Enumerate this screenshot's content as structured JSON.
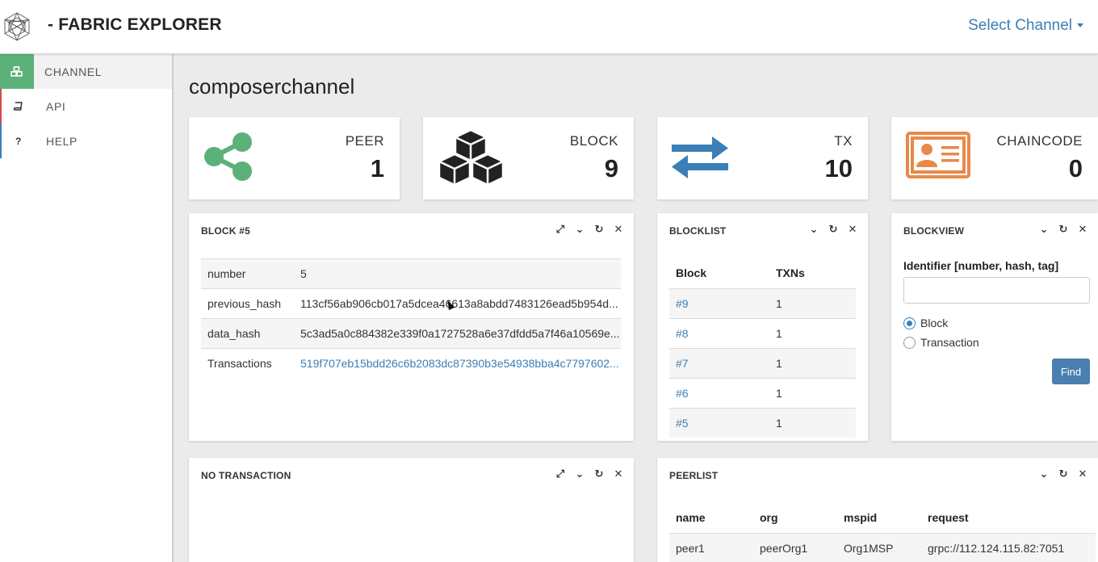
{
  "header": {
    "brand": "- FABRIC EXPLORER",
    "channel_select": "Select Channel"
  },
  "sidebar": {
    "items": [
      {
        "label": "CHANNEL",
        "icon": "cubes-icon",
        "active": true
      },
      {
        "label": "API",
        "icon": "book-icon",
        "active": false
      },
      {
        "label": "HELP",
        "icon": "question-icon",
        "active": false
      }
    ]
  },
  "page": {
    "title": "composerchannel"
  },
  "stats": [
    {
      "label": "PEER",
      "value": "1",
      "icon": "share-icon",
      "color": "#5cb07a"
    },
    {
      "label": "BLOCK",
      "value": "9",
      "icon": "cubes-icon",
      "color": "#222222"
    },
    {
      "label": "TX",
      "value": "10",
      "icon": "exchange-arrows-icon",
      "color": "#3b7fb6"
    },
    {
      "label": "CHAINCODE",
      "value": "0",
      "icon": "id-card-icon",
      "color": "#e8894a"
    }
  ],
  "block_panel": {
    "title": "BLOCK #5",
    "rows": [
      {
        "key": "number",
        "value": "5"
      },
      {
        "key": "previous_hash",
        "value": "113cf56ab906cb017a5dcea46613a8abdd7483126ead5b954d..."
      },
      {
        "key": "data_hash",
        "value": "5c3ad5a0c884382e339f0a1727528a6e37dfdd5a7f46a10569e..."
      },
      {
        "key": "Transactions",
        "value": "519f707eb15bdd26c6b2083dc87390b3e54938bba4c7797602..."
      }
    ]
  },
  "blocklist": {
    "title": "BLOCKLIST",
    "headers": [
      "Block",
      "TXNs"
    ],
    "rows": [
      {
        "block": "#9",
        "txns": "1"
      },
      {
        "block": "#8",
        "txns": "1"
      },
      {
        "block": "#7",
        "txns": "1"
      },
      {
        "block": "#6",
        "txns": "1"
      },
      {
        "block": "#5",
        "txns": "1"
      }
    ]
  },
  "blockview": {
    "title": "BLOCKVIEW",
    "identifier_label": "Identifier [number, hash, tag]",
    "input_value": "",
    "options": [
      {
        "label": "Block",
        "checked": true
      },
      {
        "label": "Transaction",
        "checked": false
      }
    ],
    "find_label": "Find"
  },
  "tx_panel": {
    "title": "NO TRANSACTION"
  },
  "peerlist": {
    "title": "PEERLIST",
    "headers": [
      "name",
      "org",
      "mspid",
      "request"
    ],
    "rows": [
      {
        "name": "peer1",
        "org": "peerOrg1",
        "mspid": "Org1MSP",
        "request": "grpc://112.124.115.82:7051"
      }
    ]
  }
}
